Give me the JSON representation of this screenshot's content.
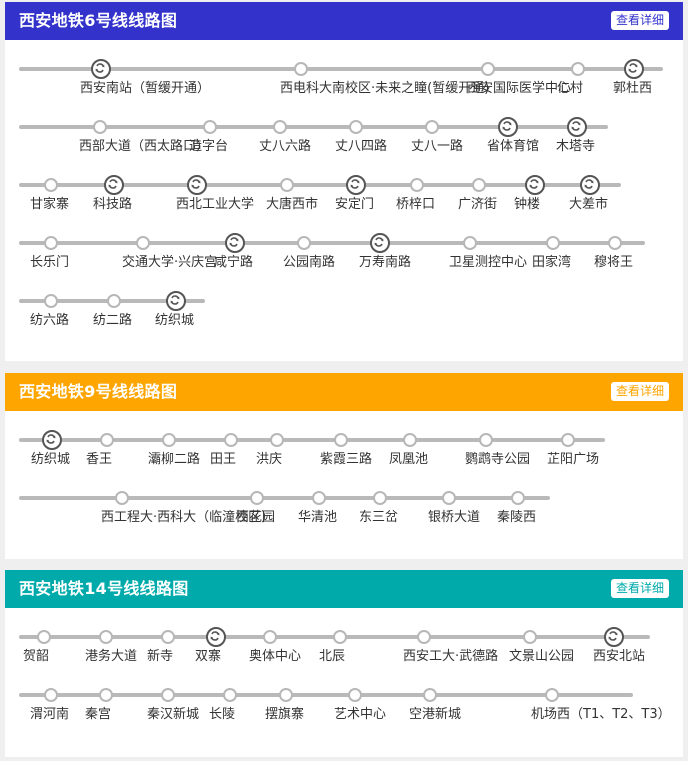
{
  "lines": [
    {
      "title": "西安地铁6号线线路图",
      "detail_label": "查看详细",
      "color": "#3333cc",
      "rows": [
        [
          {
            "name": "西安南站（暂缓开通）",
            "transfer": true
          },
          {
            "name": "西电科大南校区·未来之瞳(暂缓开通)",
            "transfer": false
          },
          {
            "name": "西安国际医学中心",
            "transfer": false
          },
          {
            "name": "仁村",
            "transfer": false
          },
          {
            "name": "郭杜西",
            "transfer": true
          }
        ],
        [
          {
            "name": "西部大道（西太路口）",
            "transfer": false
          },
          {
            "name": "造字台",
            "transfer": false
          },
          {
            "name": "丈八六路",
            "transfer": false
          },
          {
            "name": "丈八四路",
            "transfer": false
          },
          {
            "name": "丈八一路",
            "transfer": false
          },
          {
            "name": "省体育馆",
            "transfer": true
          },
          {
            "name": "木塔寺",
            "transfer": true
          }
        ],
        [
          {
            "name": "甘家寨",
            "transfer": false
          },
          {
            "name": "科技路",
            "transfer": true
          },
          {
            "name": "西北工业大学",
            "transfer": true
          },
          {
            "name": "大唐西市",
            "transfer": false
          },
          {
            "name": "安定门",
            "transfer": true
          },
          {
            "name": "桥梓口",
            "transfer": false
          },
          {
            "name": "广济街",
            "transfer": false
          },
          {
            "name": "钟楼",
            "transfer": true
          },
          {
            "name": "大差市",
            "transfer": true
          }
        ],
        [
          {
            "name": "长乐门",
            "transfer": false
          },
          {
            "name": "交通大学·兴庆宫",
            "transfer": false
          },
          {
            "name": "咸宁路",
            "transfer": true
          },
          {
            "name": "公园南路",
            "transfer": false
          },
          {
            "name": "万寿南路",
            "transfer": true
          },
          {
            "name": "卫星测控中心",
            "transfer": false
          },
          {
            "name": "田家湾",
            "transfer": false
          },
          {
            "name": "穆将王",
            "transfer": false
          }
        ],
        [
          {
            "name": "纺六路",
            "transfer": false
          },
          {
            "name": "纺二路",
            "transfer": false
          },
          {
            "name": "纺织城",
            "transfer": true
          }
        ]
      ]
    },
    {
      "title": "西安地铁9号线线路图",
      "detail_label": "查看详细",
      "color": "#ffa500",
      "rows": [
        [
          {
            "name": "纺织城",
            "transfer": true
          },
          {
            "name": "香王",
            "transfer": false
          },
          {
            "name": "灞柳二路",
            "transfer": false
          },
          {
            "name": "田王",
            "transfer": false
          },
          {
            "name": "洪庆",
            "transfer": false
          },
          {
            "name": "紫霞三路",
            "transfer": false
          },
          {
            "name": "凤凰池",
            "transfer": false
          },
          {
            "name": "鹦鹉寺公园",
            "transfer": false
          },
          {
            "name": "芷阳广场",
            "transfer": false
          }
        ],
        [
          {
            "name": "西工程大·西科大（临潼校区）",
            "transfer": false
          },
          {
            "name": "西花园",
            "transfer": false
          },
          {
            "name": "华清池",
            "transfer": false
          },
          {
            "name": "东三岔",
            "transfer": false
          },
          {
            "name": "银桥大道",
            "transfer": false
          },
          {
            "name": "秦陵西",
            "transfer": false
          }
        ]
      ]
    },
    {
      "title": "西安地铁14号线线路图",
      "detail_label": "查看详细",
      "color": "#00aaaa",
      "rows": [
        [
          {
            "name": "贺韶",
            "transfer": false
          },
          {
            "name": "港务大道",
            "transfer": false
          },
          {
            "name": "新寺",
            "transfer": false
          },
          {
            "name": "双寨",
            "transfer": true
          },
          {
            "name": "奥体中心",
            "transfer": false
          },
          {
            "name": "北辰",
            "transfer": false
          },
          {
            "name": "西安工大·武德路",
            "transfer": false
          },
          {
            "name": "文景山公园",
            "transfer": false
          },
          {
            "name": "西安北站",
            "transfer": true
          }
        ],
        [
          {
            "name": "渭河南",
            "transfer": false
          },
          {
            "name": "秦宫",
            "transfer": false
          },
          {
            "name": "秦汉新城",
            "transfer": false
          },
          {
            "name": "长陵",
            "transfer": false
          },
          {
            "name": "摆旗寨",
            "transfer": false
          },
          {
            "name": "艺术中心",
            "transfer": false
          },
          {
            "name": "空港新城",
            "transfer": false
          },
          {
            "name": "机场西（T1、T2、T3）",
            "transfer": false
          }
        ]
      ]
    }
  ]
}
